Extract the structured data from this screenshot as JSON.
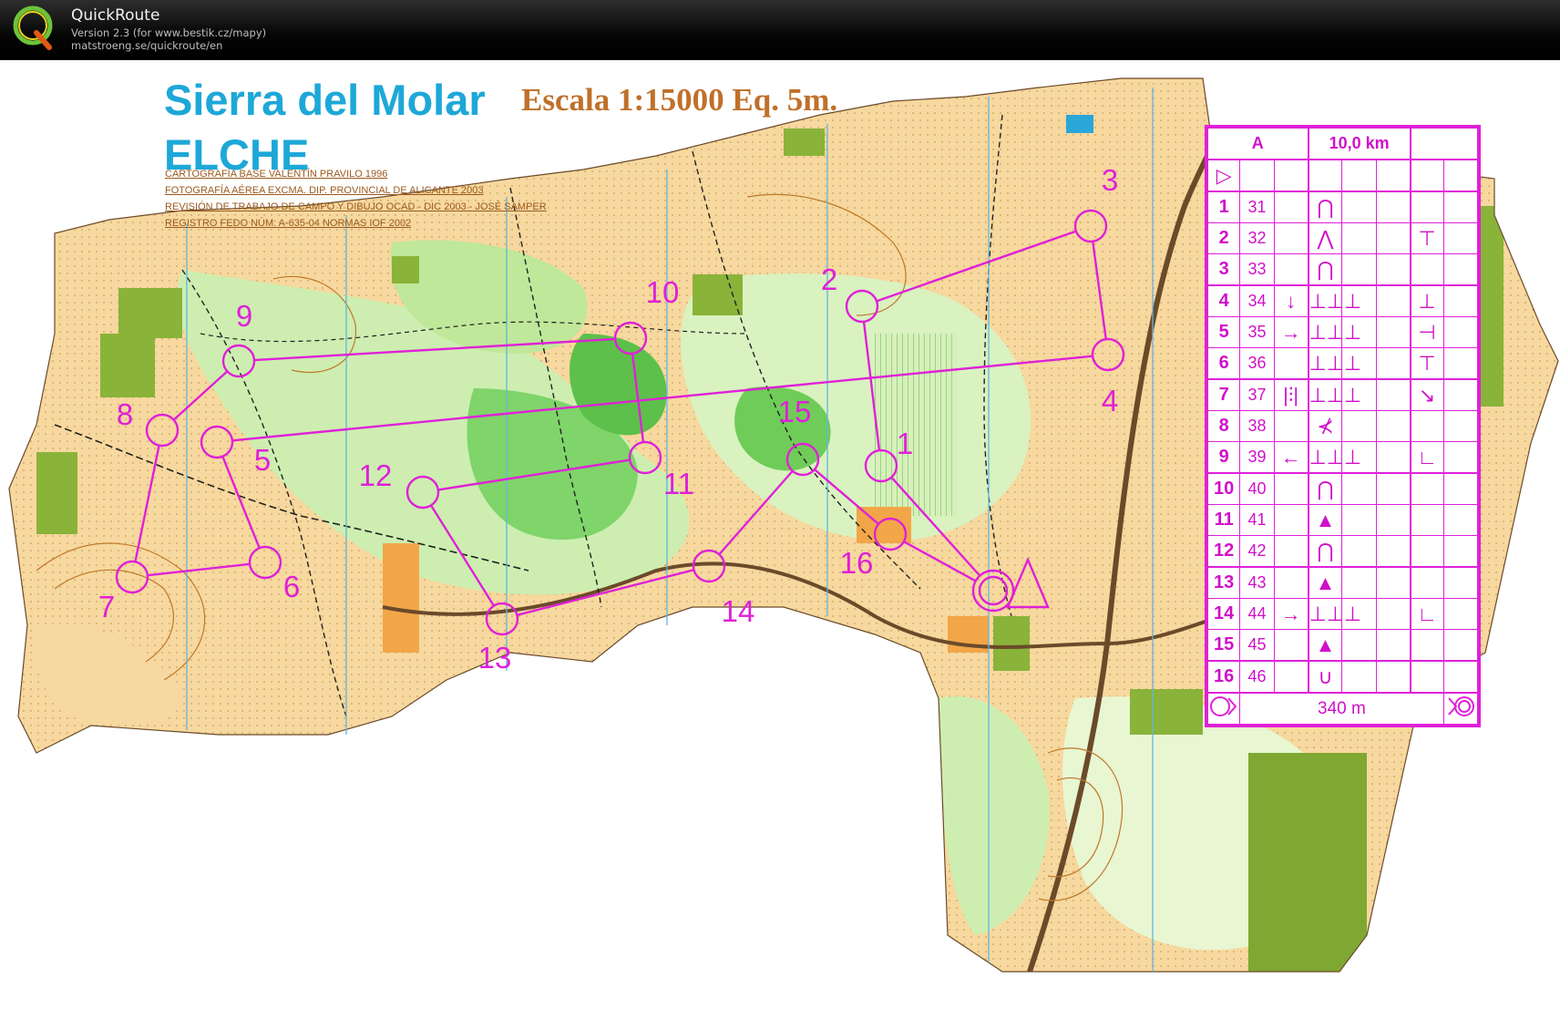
{
  "app": {
    "name": "QuickRoute",
    "version": "Version 2.3  (for www.bestik.cz/mapy)",
    "url": "matstroeng.se/quickroute/en",
    "logo_letter": "Q"
  },
  "map": {
    "title": "Sierra del Molar",
    "subtitle": "ELCHE",
    "scale": "Escala 1:15000  Eq. 5m.",
    "credits": [
      "CARTOGRAFÍA BASE VALENTÍN PRAVILO 1996",
      "FOTOGRAFÍA AÉREA EXCMA. DIP. PROVINCIAL DE ALICANTE 2003",
      "REVISIÓN DE TRABAJO DE CAMPO Y DIBUJO OCAD - DIC 2003 - JOSÉ SAMPER",
      "REGISTRO FEDO NÚM: A-635-04 NORMAS IOF 2002"
    ],
    "course_color": "#e020d8",
    "water_color": "#1da8d8",
    "scale_text_color": "#c0702a",
    "controls": [
      {
        "label": "1"
      },
      {
        "label": "2"
      },
      {
        "label": "3"
      },
      {
        "label": "4"
      },
      {
        "label": "5"
      },
      {
        "label": "6"
      },
      {
        "label": "7"
      },
      {
        "label": "8"
      },
      {
        "label": "9"
      },
      {
        "label": "10"
      },
      {
        "label": "11"
      },
      {
        "label": "12"
      },
      {
        "label": "13"
      },
      {
        "label": "14"
      },
      {
        "label": "15"
      },
      {
        "label": "16"
      }
    ]
  },
  "control_sheet": {
    "course": "A",
    "length": "10,0 km",
    "start_symbol": "▷",
    "rows": [
      {
        "num": "1",
        "code": "31",
        "c": "",
        "d": "⋂",
        "g": ""
      },
      {
        "num": "2",
        "code": "32",
        "c": "",
        "d": "⋀",
        "g": "⊤"
      },
      {
        "num": "3",
        "code": "33",
        "c": "",
        "d": "⋂",
        "g": ""
      },
      {
        "num": "4",
        "code": "34",
        "c": "↓",
        "d": "⊥⊥⊥",
        "g": "⊥"
      },
      {
        "num": "5",
        "code": "35",
        "c": "→",
        "d": "⊥⊥⊥",
        "g": "⊣"
      },
      {
        "num": "6",
        "code": "36",
        "c": "",
        "d": "⊥⊥⊥",
        "g": "⊤"
      },
      {
        "num": "7",
        "code": "37",
        "c": "|⫶|",
        "d": "⊥⊥⊥",
        "g": "↘"
      },
      {
        "num": "8",
        "code": "38",
        "c": "",
        "d": "⊀",
        "g": ""
      },
      {
        "num": "9",
        "code": "39",
        "c": "←",
        "d": "⊥⊥⊥",
        "g": "∟"
      },
      {
        "num": "10",
        "code": "40",
        "c": "",
        "d": "⋂",
        "g": ""
      },
      {
        "num": "11",
        "code": "41",
        "c": "",
        "d": "▲",
        "g": ""
      },
      {
        "num": "12",
        "code": "42",
        "c": "",
        "d": "⋂",
        "g": ""
      },
      {
        "num": "13",
        "code": "43",
        "c": "",
        "d": "▲",
        "g": ""
      },
      {
        "num": "14",
        "code": "44",
        "c": "→",
        "d": "⊥⊥⊥",
        "g": "∟"
      },
      {
        "num": "15",
        "code": "45",
        "c": "",
        "d": "▲",
        "g": ""
      },
      {
        "num": "16",
        "code": "46",
        "c": "",
        "d": "∪",
        "g": ""
      }
    ],
    "finish_distance": "340 m"
  }
}
